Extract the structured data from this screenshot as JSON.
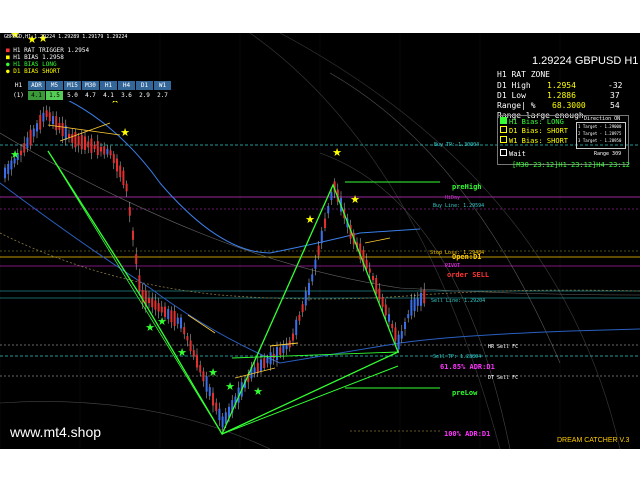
{
  "chart": {
    "title": "GBPUSD,H1 1.29224 1.29289 1.29179 1.29224",
    "legend": [
      {
        "text": "H1 RAT TRIGGER 1.2954",
        "color": "#ff3333"
      },
      {
        "text": "H1 BIAS 1.2958",
        "color": "#ffff00"
      },
      {
        "text": "H1 BIAS LONG",
        "color": "#33ff33"
      },
      {
        "text": "D1 BIAS SHORT",
        "color": "#ffff00"
      }
    ]
  },
  "tf_table": {
    "headers": [
      "H1",
      "ADR",
      "M5",
      "M15",
      "M30",
      "H1",
      "H4",
      "D1",
      "W1"
    ],
    "row_label": "(1)",
    "values": [
      "4.1",
      "1.5",
      "5.0",
      "4.7",
      "4.1",
      "3.6",
      "2.9",
      "2.7"
    ]
  },
  "panel": {
    "price_pair": "1.29224 GBPUSD H1",
    "zone_title": "H1 RAT ZONE",
    "d1_high_label": "D1 High",
    "d1_high_value": "1.2954",
    "d1_high_delta": "-32",
    "d1_low_label": "D1 Low",
    "d1_low_value": "1.2886",
    "d1_low_delta": "37",
    "range_label": "Range| %",
    "range_value": "68.3000",
    "range_pct": "54",
    "range_note": "Range large enough",
    "h1_bias": "H1 Bias: LONG",
    "direction": "Direction ON",
    "d1_bias": "D1 Bias: SHORT",
    "w1_bias": "W1 Bias: SHORT",
    "wait": "Wait",
    "range_box": "Range 309",
    "targets": [
      "1 Target - 1.29000",
      "2 Target - 1.28975",
      "3 Target - 1.28950"
    ],
    "timers": "[M30-23:12]H1-23:12]H4-23:12"
  },
  "levels": {
    "buy_tp": "Buy TP: 1.30004",
    "pre_high": "preHigh",
    "hi_day": "HiDay",
    "buy_line": "Buy Line: 1.29594",
    "stop_loss": "Stop Loss: 1.29484",
    "open_d1": "Open:D1",
    "pivot": "PIVOT",
    "order_sell": "order SELL",
    "sell_line": "Sell Line: 1.29204",
    "hr_sell_fc": "HR Sell FC",
    "sell_tp": "Sell TP: 1.28804",
    "adr_pct": "61.85% ADR:D1",
    "dt_sell": "DT Sell FC",
    "pre_low": "preLow",
    "adr_full": "100% ADR:D1"
  },
  "watermark": "www.mt4.shop",
  "brand": "DREAM CATCHER V.3",
  "colors": {
    "background": "#000000",
    "bull_candle": "#3a6fe8",
    "bear_candle": "#e03030",
    "pattern": "#33ff33",
    "level_cyan": "#33cccc",
    "level_magenta": "#ff33ff",
    "text_yellow": "#ffff00"
  }
}
